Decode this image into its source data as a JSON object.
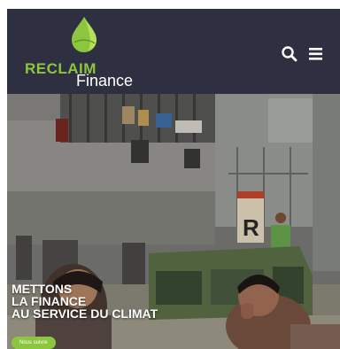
{
  "header": {
    "logo": {
      "word1": "RECLAIM",
      "word2": "Finance"
    },
    "search_icon": "search-icon",
    "menu_icon": "hamburger-menu-icon",
    "background": "#2e3041"
  },
  "hero": {
    "title_lines": [
      "METTONS",
      "LA FINANCE",
      "AU SERVICE DU CLIMAT"
    ],
    "cta_label": "Nous suivre",
    "sign_letter": "R"
  },
  "colors": {
    "brand_green": "#8cc63f",
    "accent_light_green": "#b5e05a",
    "text_white": "#ffffff"
  }
}
